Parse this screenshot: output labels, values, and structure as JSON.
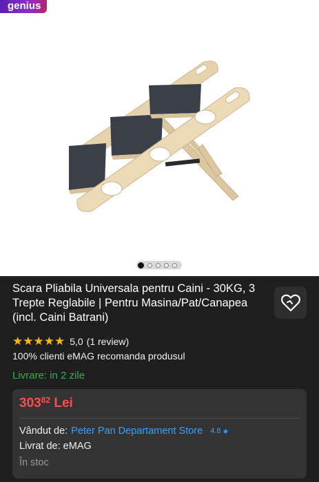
{
  "badge": {
    "label": "genius"
  },
  "product": {
    "image_alt": "Scara pliabila din lemn pentru caini",
    "carousel": {
      "count": 5,
      "active_index": 0
    },
    "title": "Scara Pliabila Universala pentru Caini - 30KG, 3 Trepte Reglabile | Pentru Masina/Pat/Canapea (incl. Caini Batrani)",
    "favorite_icon": "heart-icon",
    "rating": {
      "stars": 5,
      "value": "5,0",
      "reviews": "(1 review)"
    },
    "recommend_text": "100% clienti eMAG recomanda produsul",
    "delivery_text": "Livrare: in 2 zile"
  },
  "offer": {
    "price_main": "303",
    "price_cents": "82",
    "currency": "Lei",
    "sold_by_label": "Vândut de:",
    "seller_name": "Peter Pan Departament Store",
    "seller_rating": "4.8",
    "shipped_by": "Livrat de: eMAG",
    "stock": "În stoc"
  },
  "colors": {
    "background": "#1e1e1e",
    "price": "#ff4d4d",
    "link": "#3aa0ff",
    "delivery": "#2fb14a",
    "stars": "#f7b51f"
  }
}
